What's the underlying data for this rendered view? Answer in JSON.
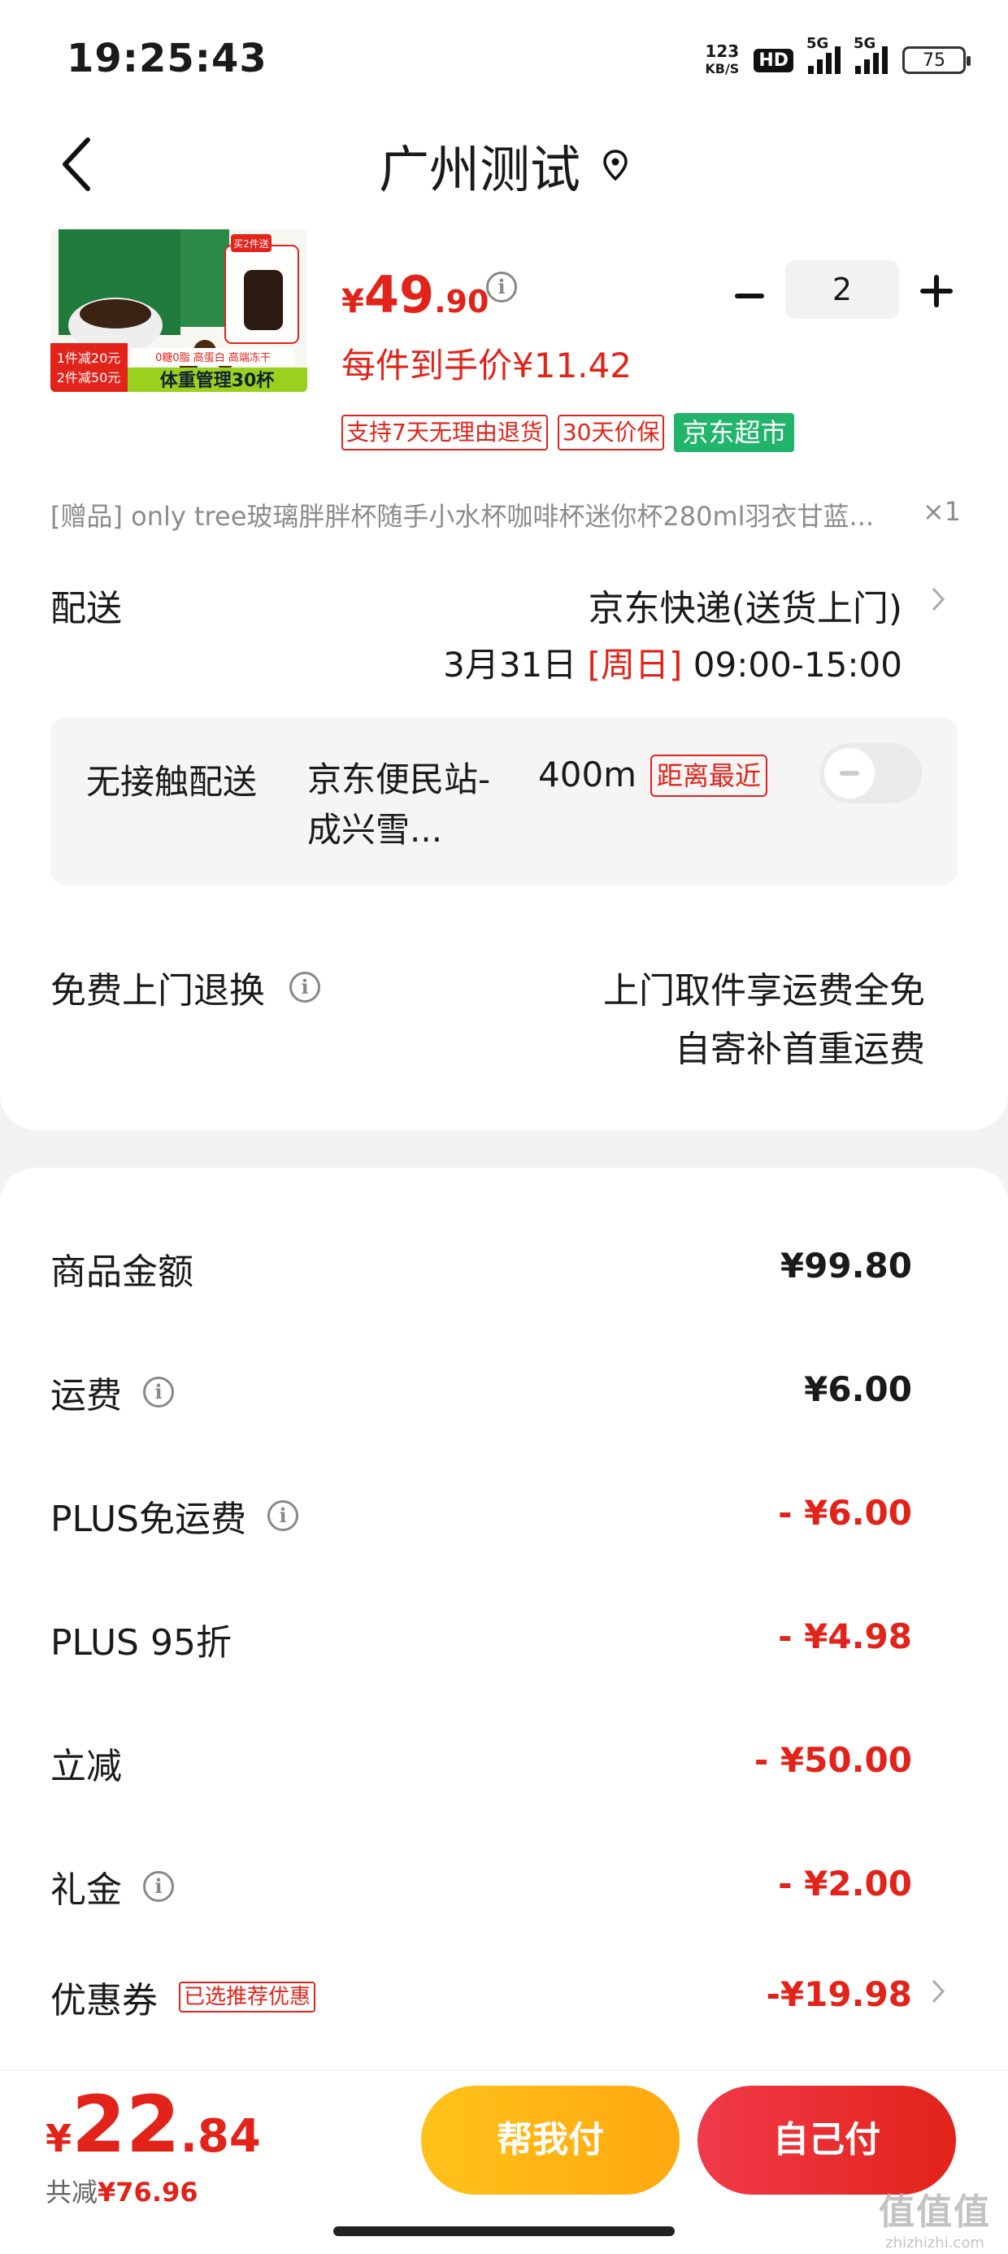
{
  "status_bar": {
    "time": "19:25:43",
    "net_speed_value": "123",
    "net_speed_unit": "KB/S",
    "hd_label": "HD",
    "signal_1": "5G",
    "signal_2": "5G",
    "battery": "75"
  },
  "nav": {
    "title": "广州测试"
  },
  "product": {
    "promo_image_lines": [
      "1件减20元",
      "2件减50元",
      "0糖0脂 高蛋白 高端冻干",
      "体重管理30杯",
      "买2件送"
    ],
    "price_currency": "¥",
    "price_integer": "49",
    "price_decimal": ".90",
    "quantity": "2",
    "unit_price_text": "每件到手价¥11.42",
    "tags": [
      "支持7天无理由退货",
      "30天价保"
    ],
    "store_tag": "京东超市"
  },
  "gift": {
    "text": "[赠品]   only tree玻璃胖胖杯随手小水杯咖啡杯迷你杯280ml羽衣甘蓝...",
    "qty": "×1"
  },
  "delivery": {
    "label": "配送",
    "method": "京东快递(送货上门)",
    "date": "3月31日",
    "weekday": "[周日]",
    "time_slot": "09:00-15:00"
  },
  "contactless": {
    "title": "无接触配送",
    "station": "京东便民站-成兴雪...",
    "distance": "400m",
    "badge": "距离最近"
  },
  "returns": {
    "label": "免费上门退换",
    "line1": "上门取件享运费全免",
    "line2": "自寄补首重运费"
  },
  "fees": [
    {
      "label": "商品金额",
      "value": "¥99.80",
      "red": false,
      "info": false
    },
    {
      "label": "运费",
      "value": "¥6.00",
      "red": false,
      "info": true
    },
    {
      "label": "PLUS免运费",
      "value": "- ¥6.00",
      "red": true,
      "info": true
    },
    {
      "label": "PLUS 95折",
      "value": "- ¥4.98",
      "red": true,
      "info": false
    },
    {
      "label": "立减",
      "value": "- ¥50.00",
      "red": true,
      "info": false
    },
    {
      "label": "礼金",
      "value": "- ¥2.00",
      "red": true,
      "info": true
    }
  ],
  "coupon": {
    "label": "优惠券",
    "badge": "已选推荐优惠",
    "value": "-¥19.98"
  },
  "footer": {
    "total_currency": "¥",
    "total_integer": "22",
    "total_decimal": ".84",
    "saved_label": "共减",
    "saved_amount": "¥76.96",
    "help_pay_label": "帮我付",
    "self_pay_label": "自己付"
  },
  "watermark": {
    "mark": "值值值",
    "url": "zhizhizhi.com"
  },
  "colors": {
    "accent_red": "#e2231a",
    "help_pay_yellow": "#ffc21a",
    "store_green": "#20b56b"
  },
  "icons": [
    "back-icon",
    "location-icon",
    "info-icon",
    "minus-icon",
    "plus-icon",
    "chevron-right-icon",
    "toggle-switch"
  ]
}
